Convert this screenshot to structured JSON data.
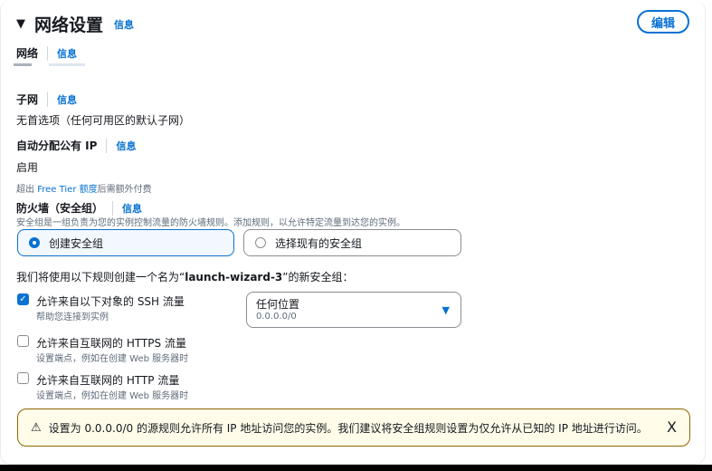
{
  "header": {
    "title": "网络设置",
    "info": "信息",
    "edit_button": "编辑"
  },
  "tabs": {
    "network": "网络",
    "info": "信息"
  },
  "subnet": {
    "label": "子网",
    "info": "信息",
    "value": "无首选项（任何可用区的默认子网）"
  },
  "public_ip": {
    "label": "自动分配公有 IP",
    "info": "信息",
    "value": "启用",
    "note_prefix": "超出 ",
    "note_link": "Free Tier 额度",
    "note_suffix": "后需额外付费"
  },
  "firewall": {
    "label": "防火墙（安全组）",
    "info": "信息",
    "description": "安全组是一组负责为您的实例控制流量的防火墙规则。添加规则，以允许特定流量到达您的实例。",
    "options": [
      {
        "label": "创建安全组",
        "selected": true
      },
      {
        "label": "选择现有的安全组",
        "selected": false
      }
    ],
    "rules_intro_prefix": "我们将使用以下规则创建一个名为“",
    "rules_intro_name": "launch-wizard-3",
    "rules_intro_suffix": "”的新安全组：",
    "rules": [
      {
        "label": "允许来自以下对象的 SSH 流量",
        "hint": "帮助您连接到实例",
        "checked": true
      },
      {
        "label": "允许来自互联网的 HTTPS 流量",
        "hint": "设置端点，例如在创建 Web 服务器时",
        "checked": false
      },
      {
        "label": "允许来自互联网的 HTTP 流量",
        "hint": "设置端点，例如在创建 Web 服务器时",
        "checked": false
      }
    ],
    "ssh_source": {
      "label": "任何位置",
      "value": "0.0.0.0/0"
    }
  },
  "alert": {
    "text": "设置为 0.0.0.0/0 的源规则允许所有 IP 地址访问您的实例。我们建议将安全组规则设置为仅允许从已知的 IP 地址进行访问。",
    "close": "X"
  },
  "colors": {
    "accent": "#0972d3",
    "warning_bg": "#fffce9",
    "warning_border": "#8d6605"
  }
}
